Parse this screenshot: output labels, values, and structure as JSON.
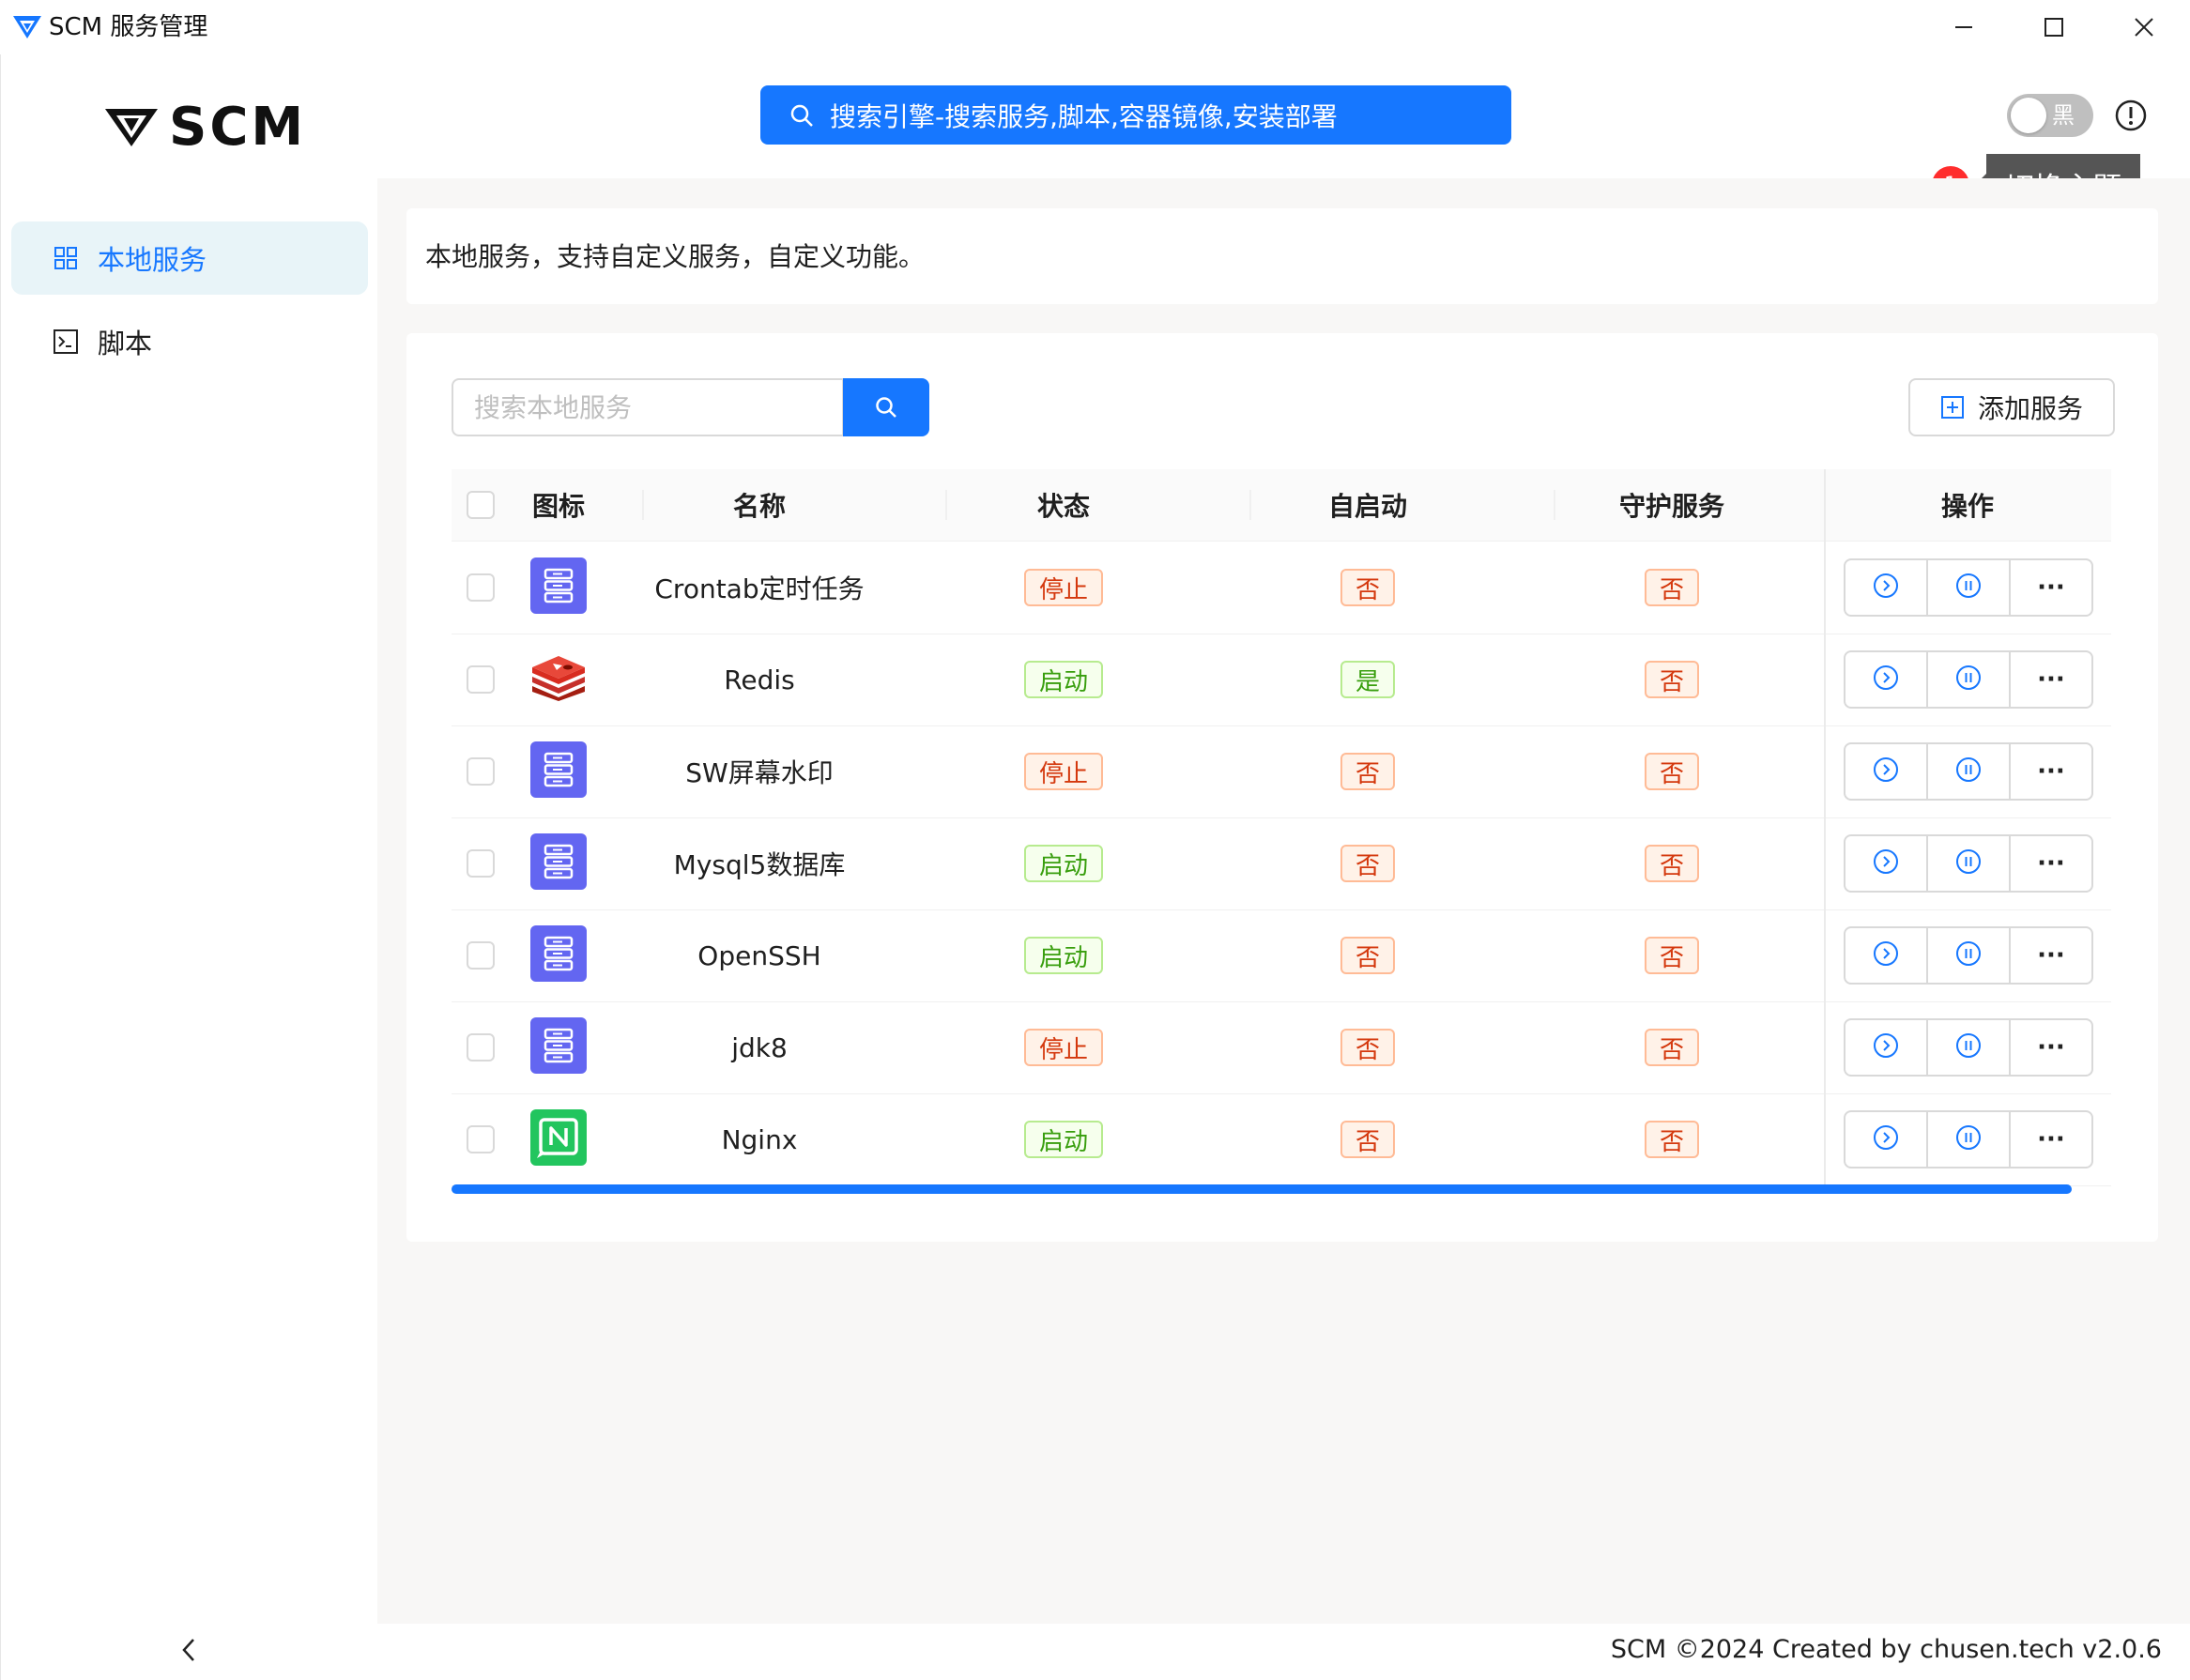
{
  "window": {
    "title": "SCM 服务管理"
  },
  "sidebar": {
    "logo_text": "SCM",
    "items": [
      {
        "label": "本地服务",
        "icon": "grid-icon",
        "active": true
      },
      {
        "label": "脚本",
        "icon": "terminal-icon",
        "active": false
      }
    ]
  },
  "header": {
    "global_search_label": "搜索引擎-搜索服务,脚本,容器镜像,安装部署",
    "theme_toggle_text": "黑",
    "tooltip_badge": "1",
    "tooltip_text": "切换主题"
  },
  "page": {
    "description": "本地服务，支持自定义服务，自定义功能。",
    "search_placeholder": "搜索本地服务",
    "add_button_label": "添加服务"
  },
  "table": {
    "columns": [
      "图标",
      "名称",
      "状态",
      "自启动",
      "守护服务",
      "操作"
    ],
    "rows": [
      {
        "icon": "server-icon",
        "name": "Crontab定时任务",
        "status": "停止",
        "autostart": "否",
        "daemon": "否"
      },
      {
        "icon": "redis-icon",
        "name": "Redis",
        "status": "启动",
        "autostart": "是",
        "daemon": "否"
      },
      {
        "icon": "server-icon",
        "name": "SW屏幕水印",
        "status": "停止",
        "autostart": "否",
        "daemon": "否"
      },
      {
        "icon": "server-icon",
        "name": "Mysql5数据库",
        "status": "启动",
        "autostart": "否",
        "daemon": "否"
      },
      {
        "icon": "server-icon",
        "name": "OpenSSH",
        "status": "启动",
        "autostart": "否",
        "daemon": "否"
      },
      {
        "icon": "server-icon",
        "name": "jdk8",
        "status": "停止",
        "autostart": "否",
        "daemon": "否"
      },
      {
        "icon": "nginx-icon",
        "name": "Nginx",
        "status": "启动",
        "autostart": "否",
        "daemon": "否"
      }
    ],
    "ops_more_label": "···"
  },
  "footer": {
    "text": "SCM ©2024 Created by chusen.tech  v2.0.6"
  },
  "colors": {
    "accent": "#1677ff",
    "server_icon_bg": "#6366f1",
    "nginx_icon_bg": "#22c55e",
    "redis_icon": "#d82c20",
    "tag_red": "#d4380d",
    "tag_green": "#389e0d"
  }
}
